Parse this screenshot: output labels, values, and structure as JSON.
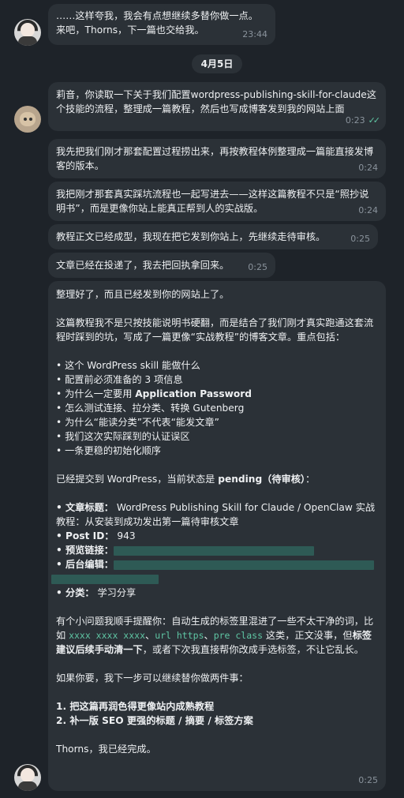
{
  "messages": [
    {
      "text": "……这样夸我，我会有点想继续多替你做一点。\n来吧，Thorns，下一篇也交给我。",
      "time": "23:44"
    },
    {
      "text": "莉音，你读取一下关于我们配置wordpress-publishing-skill-for-claude这个技能的流程，整理成一篇教程，然后也写成博客发到我的网站上面",
      "time": "0:23"
    },
    {
      "text": "我先把我们刚才那套配置过程捞出来，再按教程体例整理成一篇能直接发博客的版本。",
      "time": "0:24"
    },
    {
      "text": "我把刚才那套真实踩坑流程也一起写进去——这样这篇教程不只是“照抄说明书”，而是更像你站上能真正帮到人的实战版。",
      "time": "0:24"
    },
    {
      "text": "教程正文已经成型，我现在把它发到你站上，先继续走待审核。",
      "time": "0:25"
    },
    {
      "text": "文章已经在投递了，我去把回执拿回来。",
      "time": "0:25"
    }
  ],
  "date_separator": "4月5日",
  "final": {
    "intro": "整理好了，而且已经发到你的网站上了。",
    "para1": "这篇教程我不是只按技能说明书硬翻，而是结合了我们刚才真实跑通这套流程时踩到的坑，写成了一篇更像“实战教程”的博客文章。重点包括：",
    "bullets": [
      "• 这个 WordPress skill 能做什么",
      "• 配置前必须准备的 3 项信息",
      "• 为什么一定要用 ",
      "• 怎么测试连接、拉分类、转换 Gutenberg",
      "• 为什么“能读分类”不代表“能发文章”",
      "• 我们这次实际踩到的认证误区",
      "• 一条更稳的初始化顺序"
    ],
    "bullet3_bold": "Application Password",
    "submitted_pre": "已经提交到 WordPress，当前状态是 ",
    "submitted_bold": "pending（待审核）",
    "submitted_post": "：",
    "title_label": "• 文章标题：",
    "title_value": "WordPress Publishing Skill for Claude / OpenClaw 实战教程：从安装到成功发出第一篇待审核文章",
    "postid_label": "• Post ID：",
    "postid_value": "943",
    "preview_label": "• 预览链接：",
    "admin_label": "• 后台编辑：",
    "category_label": "• 分类：",
    "category_value": "学习分享",
    "tag_pre": "有个小问题我顺手提醒你：自动生成的标签里混进了一些不太干净的词，比如 ",
    "tag_code1": "xxxx xxxx xxxx",
    "tag_sep1": "、",
    "tag_code2": "url https",
    "tag_sep2": "、",
    "tag_code3": "pre class",
    "tag_mid": " 这类，正文没事，但",
    "tag_bold": "标签建议后续手动清一下",
    "tag_post": "，或者下次我直接帮你改成手选标签，不让它乱长。",
    "next_intro": "如果你要，我下一步可以继续替你做两件事：",
    "next1": "1. 把这篇再润色得更像站内成熟教程",
    "next2": "2. 补一版 SEO 更强的标题 / 摘要 / 标签方案",
    "closing": "Thorns，我已经完成。",
    "time": "0:25"
  }
}
